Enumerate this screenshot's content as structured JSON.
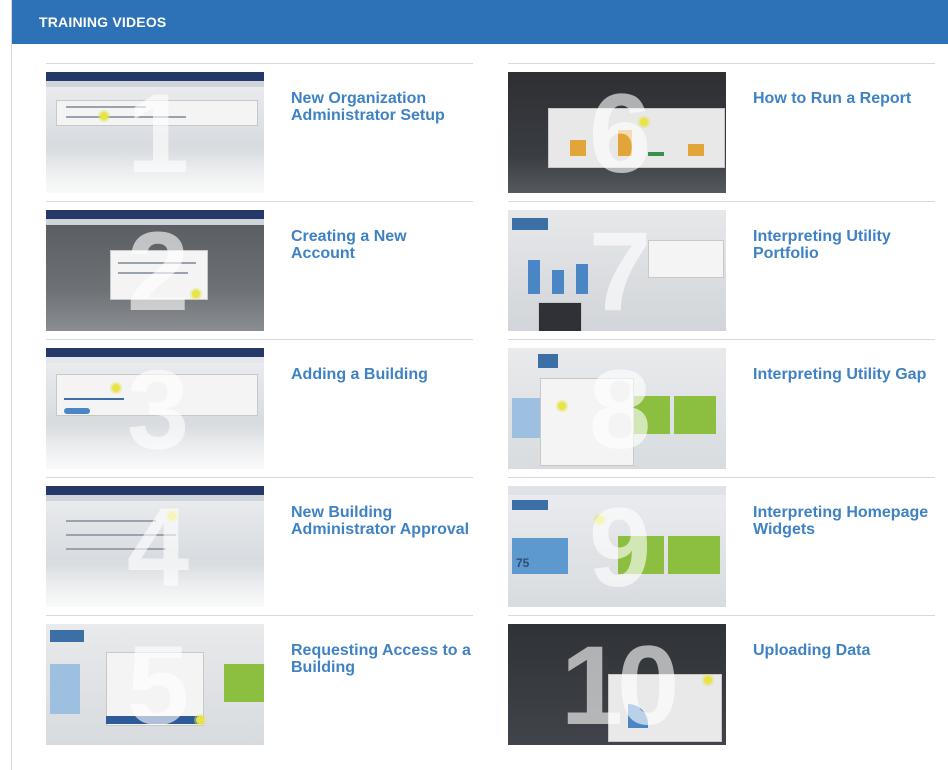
{
  "header": {
    "title": "TRAINING VIDEOS"
  },
  "videos": [
    {
      "number": "1",
      "title": "New Organization Administrator Setup"
    },
    {
      "number": "2",
      "title": "Creating a New Account"
    },
    {
      "number": "3",
      "title": "Adding a Building"
    },
    {
      "number": "4",
      "title": "New Building Administrator Approval"
    },
    {
      "number": "5",
      "title": "Requesting Access to a Building"
    },
    {
      "number": "6",
      "title": "How to Run a Report"
    },
    {
      "number": "7",
      "title": "Interpreting Utility Portfolio"
    },
    {
      "number": "8",
      "title": "Interpreting Utility Gap"
    },
    {
      "number": "9",
      "title": "Interpreting Homepage Widgets"
    },
    {
      "number": "10",
      "title": "Uploading Data"
    }
  ],
  "thumbnail_text": {
    "widget_value": "75"
  },
  "colors": {
    "header_bg": "#2d72b7",
    "link": "#3f82c4",
    "thumb_highlight": "#e9e34a"
  }
}
